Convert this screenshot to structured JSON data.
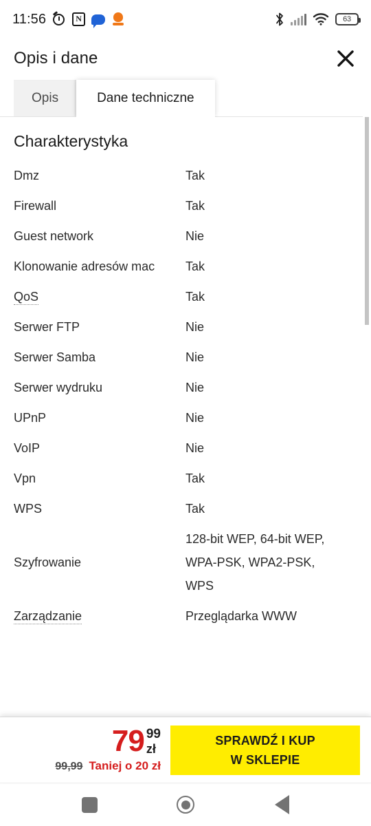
{
  "status_bar": {
    "time": "11:56",
    "left_icons": [
      "alarm-icon",
      "nfc-icon",
      "message-icon",
      "app-icon"
    ],
    "right_icons": [
      "bluetooth-icon",
      "signal-icon",
      "wifi-icon",
      "battery-icon"
    ],
    "battery_level": "63"
  },
  "header": {
    "title": "Opis i dane",
    "close_label": "close-icon"
  },
  "tabs": [
    {
      "label": "Opis",
      "active": false
    },
    {
      "label": "Dane techniczne",
      "active": true
    }
  ],
  "content": {
    "section_title": "Charakterystyka",
    "specs": [
      {
        "label": "Dmz",
        "value": "Tak",
        "tooltip": false
      },
      {
        "label": "Firewall",
        "value": "Tak",
        "tooltip": false
      },
      {
        "label": "Guest network",
        "value": "Nie",
        "tooltip": false
      },
      {
        "label": "Klonowanie adresów mac",
        "value": "Tak",
        "tooltip": false
      },
      {
        "label": "QoS",
        "value": "Tak",
        "tooltip": true
      },
      {
        "label": "Serwer FTP",
        "value": "Nie",
        "tooltip": false
      },
      {
        "label": "Serwer Samba",
        "value": "Nie",
        "tooltip": false
      },
      {
        "label": "Serwer wydruku",
        "value": "Nie",
        "tooltip": false
      },
      {
        "label": "UPnP",
        "value": "Nie",
        "tooltip": false
      },
      {
        "label": "VoIP",
        "value": "Nie",
        "tooltip": false
      },
      {
        "label": "Vpn",
        "value": "Tak",
        "tooltip": false
      },
      {
        "label": "WPS",
        "value": "Tak",
        "tooltip": false
      },
      {
        "label": "Szyfrowanie",
        "value": "128-bit WEP, 64-bit WEP, WPA-PSK, WPA2-PSK, WPS",
        "tooltip": false
      },
      {
        "label": "Zarządzanie",
        "value": "Przeglądarka WWW",
        "tooltip": true
      }
    ]
  },
  "price_bar": {
    "price_integer": "79",
    "price_cents": "99",
    "currency": "zł",
    "old_price": "99,99",
    "savings": "Taniej o 20 zł",
    "cta_line1": "SPRAWDŹ I KUP",
    "cta_line2": "W SKLEPIE"
  },
  "nav_bar": {
    "recents": "recents-square-icon",
    "home": "home-circle-icon",
    "back": "back-triangle-icon"
  },
  "colors": {
    "price_red": "#d51d1d",
    "cta_yellow": "#ffed00",
    "tab_inactive_bg": "#f1f1f1",
    "scrollbar": "#c4c4c4"
  }
}
